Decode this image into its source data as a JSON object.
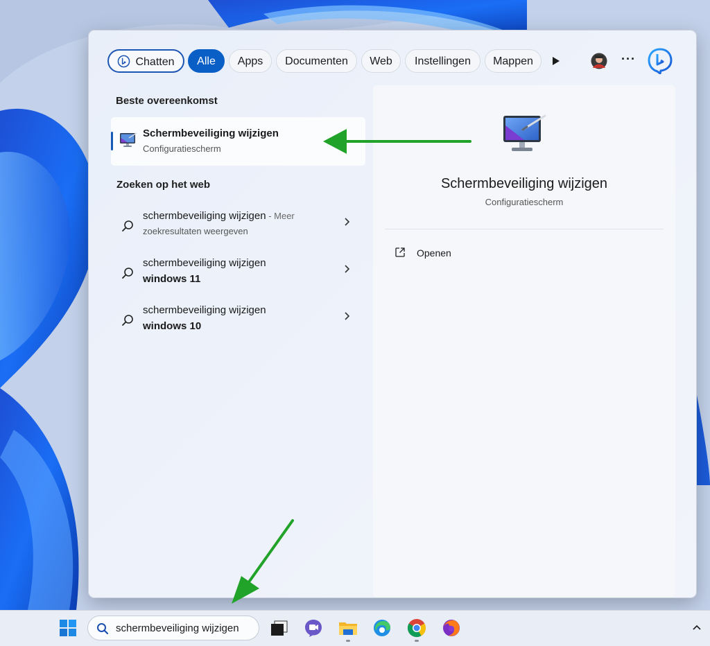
{
  "filters": {
    "chat_label": "Chatten",
    "items": [
      "Alle",
      "Apps",
      "Documenten",
      "Web",
      "Instellingen",
      "Mappen"
    ],
    "active": "Alle",
    "more_label": "···"
  },
  "best_match": {
    "heading": "Beste overeenkomst",
    "title": "Schermbeveiliging wijzigen",
    "subtitle": "Configuratiescherm",
    "icon": "screensaver-monitor-icon"
  },
  "web": {
    "heading": "Zoeken op het web",
    "results": [
      {
        "query": "schermbeveiliging wijzigen",
        "suffix": " - Meer",
        "line2": "zoekresultaten weergeven"
      },
      {
        "query": "schermbeveiliging wijzigen",
        "line2": "windows 11"
      },
      {
        "query": "schermbeveiliging wijzigen",
        "line2": "windows 10"
      }
    ]
  },
  "preview": {
    "title": "Schermbeveiliging wijzigen",
    "subtitle": "Configuratiescherm",
    "actions": [
      {
        "label": "Openen",
        "icon": "open-external-icon"
      }
    ]
  },
  "taskbar": {
    "search_value": "schermbeveiliging wijzigen",
    "apps": [
      "start-icon",
      "task-view-icon",
      "teams-chat-icon",
      "file-explorer-icon",
      "edge-icon",
      "chrome-icon",
      "firefox-icon"
    ],
    "tray_icon": "chevron-up-icon"
  },
  "colors": {
    "accent": "#0a5fc7",
    "annotation_arrow": "#21a32a"
  }
}
